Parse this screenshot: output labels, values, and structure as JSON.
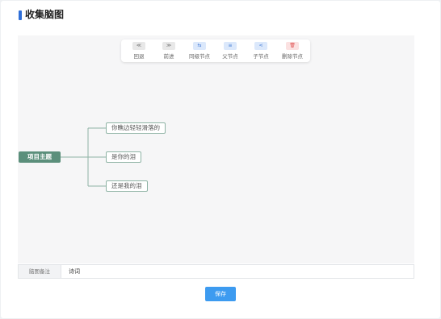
{
  "page": {
    "title": "收集脑图"
  },
  "toolbar": {
    "items": [
      {
        "label": "回退",
        "icon": "double-chevron-left-icon",
        "glyph": "≪"
      },
      {
        "label": "前进",
        "icon": "double-chevron-right-icon",
        "glyph": "≫"
      },
      {
        "label": "同级节点",
        "icon": "sibling-node-icon",
        "glyph": "⇆"
      },
      {
        "label": "父节点",
        "icon": "parent-node-icon",
        "glyph": "≡"
      },
      {
        "label": "子节点",
        "icon": "child-node-icon",
        "glyph": "⋖"
      },
      {
        "label": "删除节点",
        "icon": "trash-icon",
        "glyph": "🗑"
      }
    ]
  },
  "mindmap": {
    "root": "项目主题",
    "children": [
      "你瞧边轻轻滑落的",
      "是你的泪",
      "还是我的泪"
    ]
  },
  "remark": {
    "label": "脑图备注",
    "value": "诗词"
  },
  "save_label": "保存",
  "colors": {
    "accent": "#2f6fd8",
    "root_node": "#5b8f7b",
    "save_button": "#3d9bf0"
  }
}
